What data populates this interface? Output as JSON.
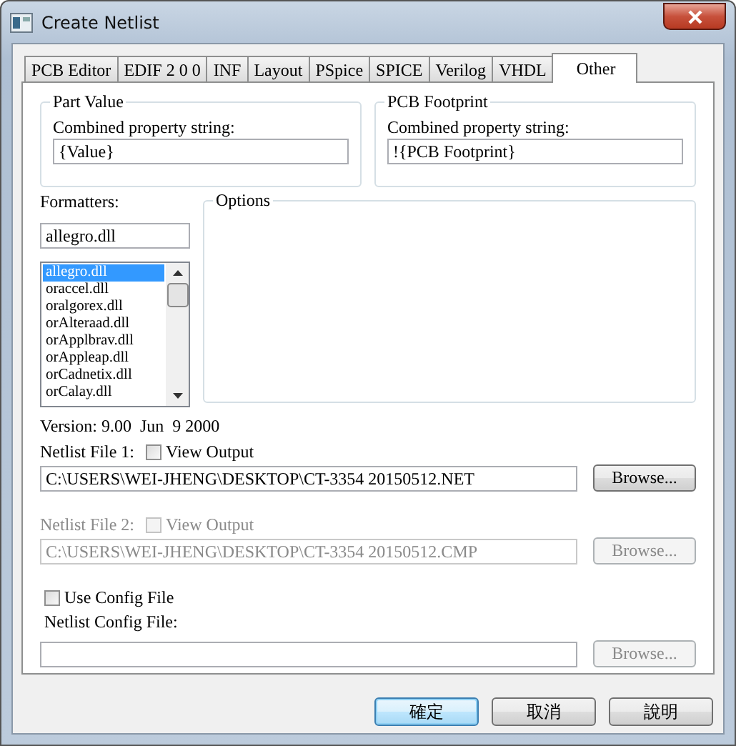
{
  "window": {
    "title": "Create Netlist"
  },
  "tabs": [
    {
      "label": "PCB Editor",
      "selected": false
    },
    {
      "label": "EDIF 2 0 0",
      "selected": false
    },
    {
      "label": "INF",
      "selected": false
    },
    {
      "label": "Layout",
      "selected": false
    },
    {
      "label": "PSpice",
      "selected": false
    },
    {
      "label": "SPICE",
      "selected": false
    },
    {
      "label": "Verilog",
      "selected": false
    },
    {
      "label": "VHDL",
      "selected": false
    },
    {
      "label": "Other",
      "selected": true
    }
  ],
  "property_groups": [
    {
      "title": "Part Value",
      "label": "Combined property string:",
      "value": "{Value}"
    },
    {
      "title": "PCB Footprint",
      "label": "Combined property string:",
      "value": "!{PCB Footprint}"
    }
  ],
  "formatters": {
    "label": "Formatters:",
    "value": "allegro.dll",
    "items": [
      {
        "label": "allegro.dll",
        "selected": true
      },
      {
        "label": "oraccel.dll",
        "selected": false
      },
      {
        "label": "oralgorex.dll",
        "selected": false
      },
      {
        "label": "orAlteraad.dll",
        "selected": false
      },
      {
        "label": "orApplbrav.dll",
        "selected": false
      },
      {
        "label": "orAppleap.dll",
        "selected": false
      },
      {
        "label": "orCadnetix.dll",
        "selected": false
      },
      {
        "label": "orCalay.dll",
        "selected": false
      }
    ]
  },
  "options": {
    "title": "Options"
  },
  "version": "Version: 9.00  Jun  9 2000",
  "netlist_files": [
    {
      "label": "Netlist File 1:",
      "disabled": false,
      "view_output": {
        "label": "View Output",
        "checked": false
      },
      "path": "C:\\USERS\\WEI-JHENG\\DESKTOP\\CT-3354 20150512.NET",
      "browse": "Browse..."
    },
    {
      "label": "Netlist File 2:",
      "disabled": true,
      "view_output": {
        "label": "View Output",
        "checked": false
      },
      "path": "C:\\USERS\\WEI-JHENG\\DESKTOP\\CT-3354 20150512.CMP",
      "browse": "Browse..."
    }
  ],
  "config": {
    "use_config": {
      "label": "Use Config File",
      "checked": false
    },
    "label": "Netlist Config File:",
    "browse": "Browse...",
    "browse_disabled": true
  },
  "buttons": [
    {
      "label": "確定",
      "default": true
    },
    {
      "label": "取消",
      "default": false
    },
    {
      "label": "說明",
      "default": false
    }
  ]
}
